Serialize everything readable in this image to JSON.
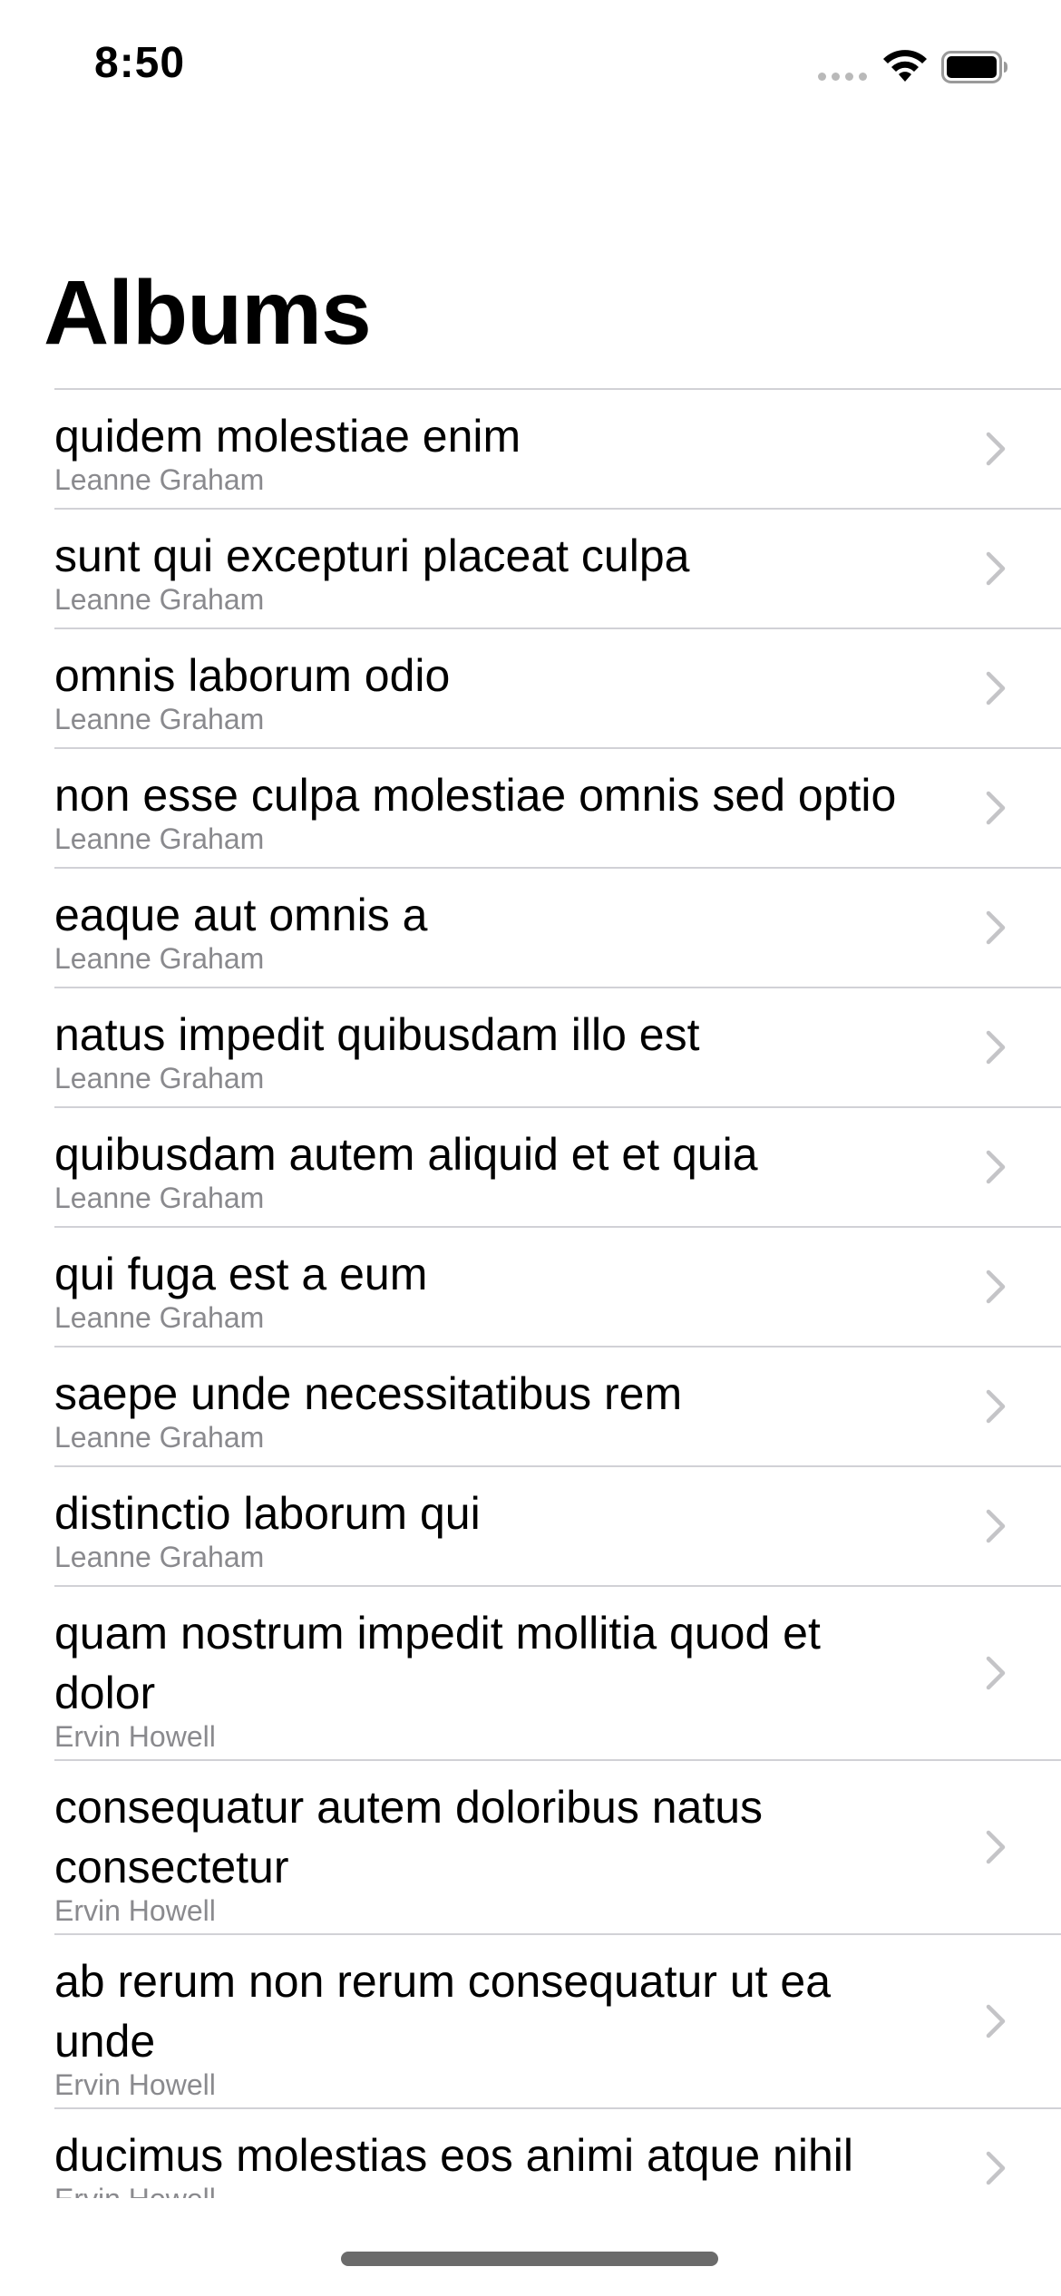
{
  "status_bar": {
    "time": "8:50"
  },
  "nav": {
    "title": "Albums"
  },
  "albums": [
    {
      "title": "quidem molestiae enim",
      "artist": "Leanne Graham",
      "lines": 1
    },
    {
      "title": "sunt qui excepturi placeat culpa",
      "artist": "Leanne Graham",
      "lines": 1
    },
    {
      "title": "omnis laborum odio",
      "artist": "Leanne Graham",
      "lines": 1
    },
    {
      "title": "non esse culpa molestiae omnis sed optio",
      "artist": "Leanne Graham",
      "lines": 1
    },
    {
      "title": "eaque aut omnis a",
      "artist": "Leanne Graham",
      "lines": 1
    },
    {
      "title": "natus impedit quibusdam illo est",
      "artist": "Leanne Graham",
      "lines": 1
    },
    {
      "title": "quibusdam autem aliquid et et quia",
      "artist": "Leanne Graham",
      "lines": 1
    },
    {
      "title": "qui fuga est a eum",
      "artist": "Leanne Graham",
      "lines": 1
    },
    {
      "title": "saepe unde necessitatibus rem",
      "artist": "Leanne Graham",
      "lines": 1
    },
    {
      "title": "distinctio laborum qui",
      "artist": "Leanne Graham",
      "lines": 1
    },
    {
      "title": "quam nostrum impedit mollitia quod et dolor",
      "artist": "Ervin Howell",
      "lines": 2
    },
    {
      "title": "consequatur autem doloribus natus consectetur",
      "artist": "Ervin Howell",
      "lines": 2
    },
    {
      "title": "ab rerum non rerum consequatur ut ea unde",
      "artist": "Ervin Howell",
      "lines": 2
    },
    {
      "title": "ducimus molestias eos animi atque nihil",
      "artist": "Ervin Howell",
      "lines": 1
    }
  ],
  "icons": {
    "row_accessory": "chevron-right-icon",
    "wifi": "wifi-icon",
    "battery": "battery-icon",
    "signal": "cellular-signal-icon"
  },
  "colors": {
    "separator": "#d1d1d6",
    "subtitle": "#8a8a8e",
    "chevron": "#c4c4c7"
  }
}
